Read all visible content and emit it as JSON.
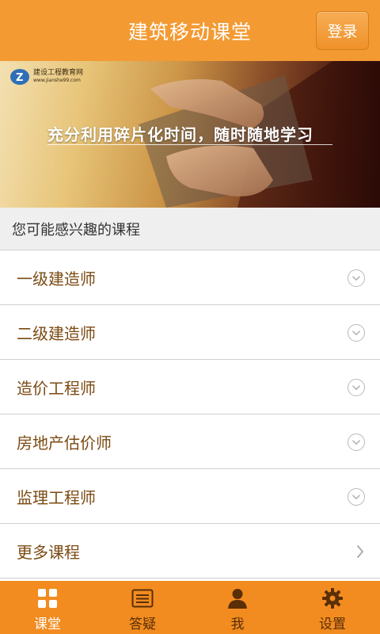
{
  "header": {
    "title": "建筑移动课堂",
    "login_label": "登录"
  },
  "banner": {
    "logo_name": "建设工程教育网",
    "logo_url": "www.jianshe99.com",
    "slogan": "充分利用碎片化时间，随时随地学习"
  },
  "section": {
    "title": "您可能感兴趣的课程"
  },
  "courses": [
    {
      "label": "一级建造师",
      "icon": "chevron-down-circle-icon"
    },
    {
      "label": "二级建造师",
      "icon": "chevron-down-circle-icon"
    },
    {
      "label": "造价工程师",
      "icon": "chevron-down-circle-icon"
    },
    {
      "label": "房地产估价师",
      "icon": "chevron-down-circle-icon"
    },
    {
      "label": "监理工程师",
      "icon": "chevron-down-circle-icon"
    },
    {
      "label": "更多课程",
      "icon": "chevron-right-icon"
    }
  ],
  "tabs": [
    {
      "label": "课堂",
      "icon": "grid-icon",
      "active": true
    },
    {
      "label": "答疑",
      "icon": "list-icon",
      "active": false
    },
    {
      "label": "我",
      "icon": "user-icon",
      "active": false
    },
    {
      "label": "设置",
      "icon": "gear-icon",
      "active": false
    }
  ],
  "colors": {
    "accent": "#f39a32",
    "tabbar": "#f28c20",
    "course_text": "#7b4a12"
  }
}
